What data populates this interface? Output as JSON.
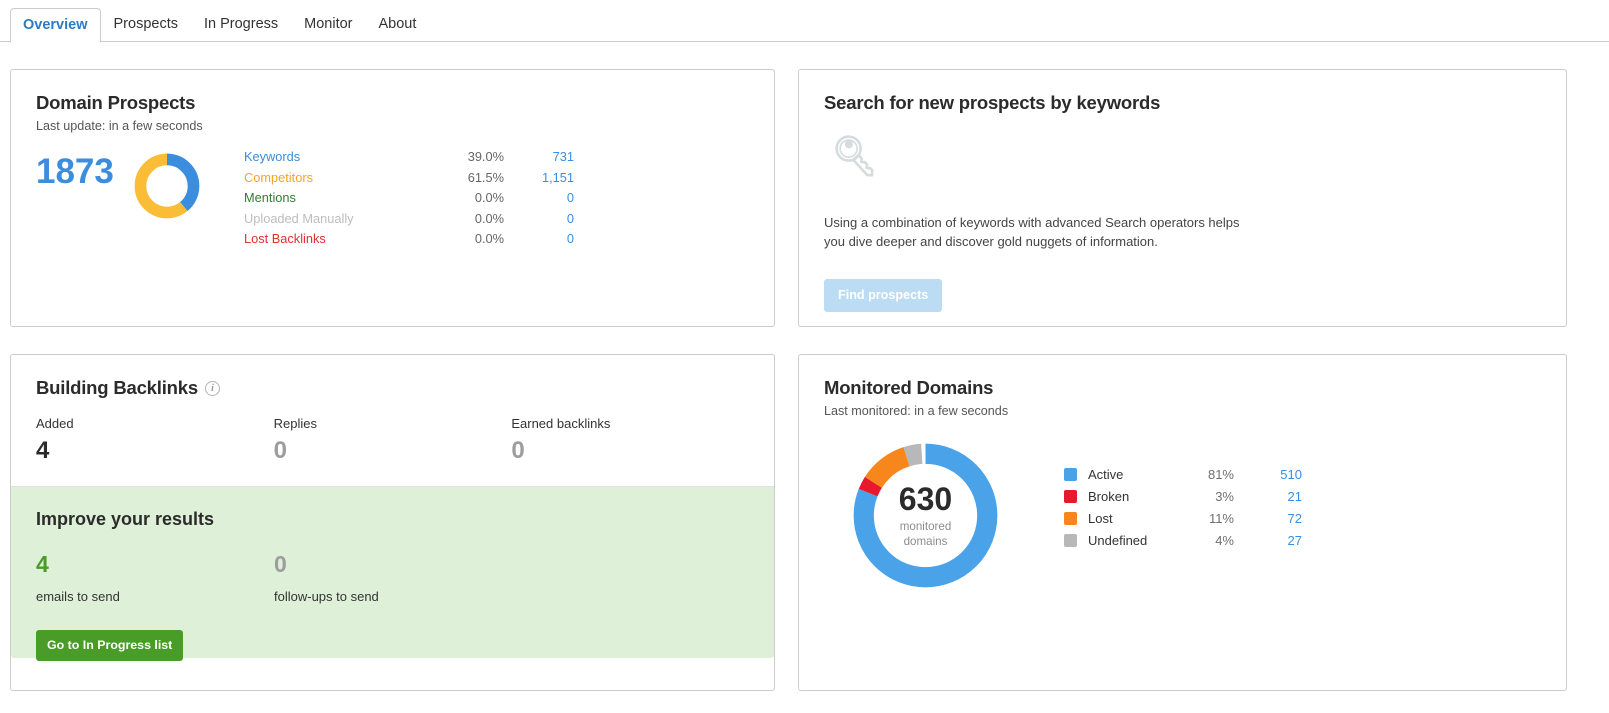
{
  "tabs": [
    {
      "label": "Overview",
      "active": true
    },
    {
      "label": "Prospects",
      "active": false
    },
    {
      "label": "In Progress",
      "active": false
    },
    {
      "label": "Monitor",
      "active": false
    },
    {
      "label": "About",
      "active": false
    }
  ],
  "domain_prospects": {
    "title": "Domain Prospects",
    "subtitle": "Last update: in a few seconds",
    "total": "1873",
    "rows": [
      {
        "label": "Keywords",
        "percent": "39.0%",
        "value": "731",
        "color": "#3b8edd"
      },
      {
        "label": "Competitors",
        "percent": "61.5%",
        "value": "1,151",
        "color": "#f5a623"
      },
      {
        "label": "Mentions",
        "percent": "0.0%",
        "value": "0",
        "color": "#2e7d32"
      },
      {
        "label": "Uploaded Manually",
        "percent": "0.0%",
        "value": "0",
        "color": "#bdbdbd"
      },
      {
        "label": "Lost Backlinks",
        "percent": "0.0%",
        "value": "0",
        "color": "#e03030"
      }
    ]
  },
  "search_card": {
    "title": "Search for new prospects by keywords",
    "icon": "key-icon",
    "description": "Using a combination of keywords with advanced Search operators helps you dive deeper and discover gold nuggets of information.",
    "button_label": "Find prospects"
  },
  "building_backlinks": {
    "title": "Building Backlinks",
    "info_icon": "info-icon",
    "stats": [
      {
        "label": "Added",
        "value": "4",
        "muted": false
      },
      {
        "label": "Replies",
        "value": "0",
        "muted": true
      },
      {
        "label": "Earned backlinks",
        "value": "0",
        "muted": true
      }
    ],
    "improve": {
      "title": "Improve your results",
      "stats": [
        {
          "value": "4",
          "caption": "emails to send",
          "muted": false
        },
        {
          "value": "0",
          "caption": "follow-ups to send",
          "muted": true
        }
      ],
      "button_label": "Go to In Progress list"
    }
  },
  "monitored_domains": {
    "title": "Monitored Domains",
    "subtitle": "Last monitored: in a few seconds",
    "center_number": "630",
    "center_caption_line1": "monitored",
    "center_caption_line2": "domains",
    "legend": [
      {
        "label": "Active",
        "percent": "81%",
        "value": "510",
        "color": "#4aa3e8"
      },
      {
        "label": "Broken",
        "percent": "3%",
        "value": "21",
        "color": "#e8192c"
      },
      {
        "label": "Lost",
        "percent": "11%",
        "value": "72",
        "color": "#f7861c"
      },
      {
        "label": "Undefined",
        "percent": "4%",
        "value": "27",
        "color": "#b8b8b8"
      }
    ]
  },
  "chart_data": [
    {
      "type": "pie",
      "title": "Domain Prospects",
      "categories": [
        "Keywords",
        "Competitors",
        "Mentions",
        "Uploaded Manually",
        "Lost Backlinks"
      ],
      "values": [
        731,
        1151,
        0,
        0,
        0
      ],
      "percentages": [
        39.0,
        61.5,
        0.0,
        0.0,
        0.0
      ],
      "colors": [
        "#3b8edd",
        "#fbbc36",
        "#2e7d32",
        "#bdbdbd",
        "#e03030"
      ],
      "total": 1873,
      "legend_position": "right",
      "donut": true
    },
    {
      "type": "pie",
      "title": "Monitored Domains",
      "categories": [
        "Active",
        "Broken",
        "Lost",
        "Undefined"
      ],
      "values": [
        510,
        21,
        72,
        27
      ],
      "percentages": [
        81,
        3,
        11,
        4
      ],
      "colors": [
        "#4aa3e8",
        "#e8192c",
        "#f7861c",
        "#b8b8b8"
      ],
      "total": 630,
      "center_label": "630 monitored domains",
      "legend_position": "right",
      "donut": true
    }
  ]
}
